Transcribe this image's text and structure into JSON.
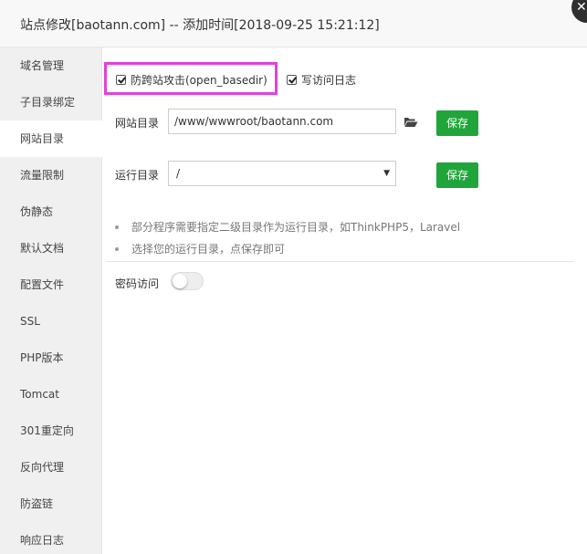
{
  "dialog": {
    "title": "站点修改[baotann.com] -- 添加时间[2018-09-25 15:21:12]",
    "close_icon": "close-icon"
  },
  "sidebar": {
    "items": [
      {
        "label": "域名管理",
        "active": false
      },
      {
        "label": "子目录绑定",
        "active": false
      },
      {
        "label": "网站目录",
        "active": true
      },
      {
        "label": "流量限制",
        "active": false
      },
      {
        "label": "伪静态",
        "active": false
      },
      {
        "label": "默认文档",
        "active": false
      },
      {
        "label": "配置文件",
        "active": false
      },
      {
        "label": "SSL",
        "active": false
      },
      {
        "label": "PHP版本",
        "active": false
      },
      {
        "label": "Tomcat",
        "active": false
      },
      {
        "label": "301重定向",
        "active": false
      },
      {
        "label": "反向代理",
        "active": false
      },
      {
        "label": "防盗链",
        "active": false
      },
      {
        "label": "响应日志",
        "active": false
      }
    ]
  },
  "main": {
    "open_basedir": {
      "label": "防跨站攻击(open_basedir)",
      "checked": true
    },
    "access_log": {
      "label": "写访问日志",
      "checked": true
    },
    "site_dir": {
      "label": "网站目录",
      "value": "/www/wwwroot/baotann.com",
      "folder_icon": "folder-open-icon",
      "save_label": "保存"
    },
    "run_dir": {
      "label": "运行目录",
      "value": "/",
      "save_label": "保存"
    },
    "tips": [
      "部分程序需要指定二级目录作为运行目录，如ThinkPHP5，Laravel",
      "选择您的运行目录，点保存即可"
    ],
    "password_access": {
      "label": "密码访问",
      "enabled": false
    }
  },
  "colors": {
    "accent_green": "#20a53a",
    "highlight_magenta": "#e040e0"
  }
}
